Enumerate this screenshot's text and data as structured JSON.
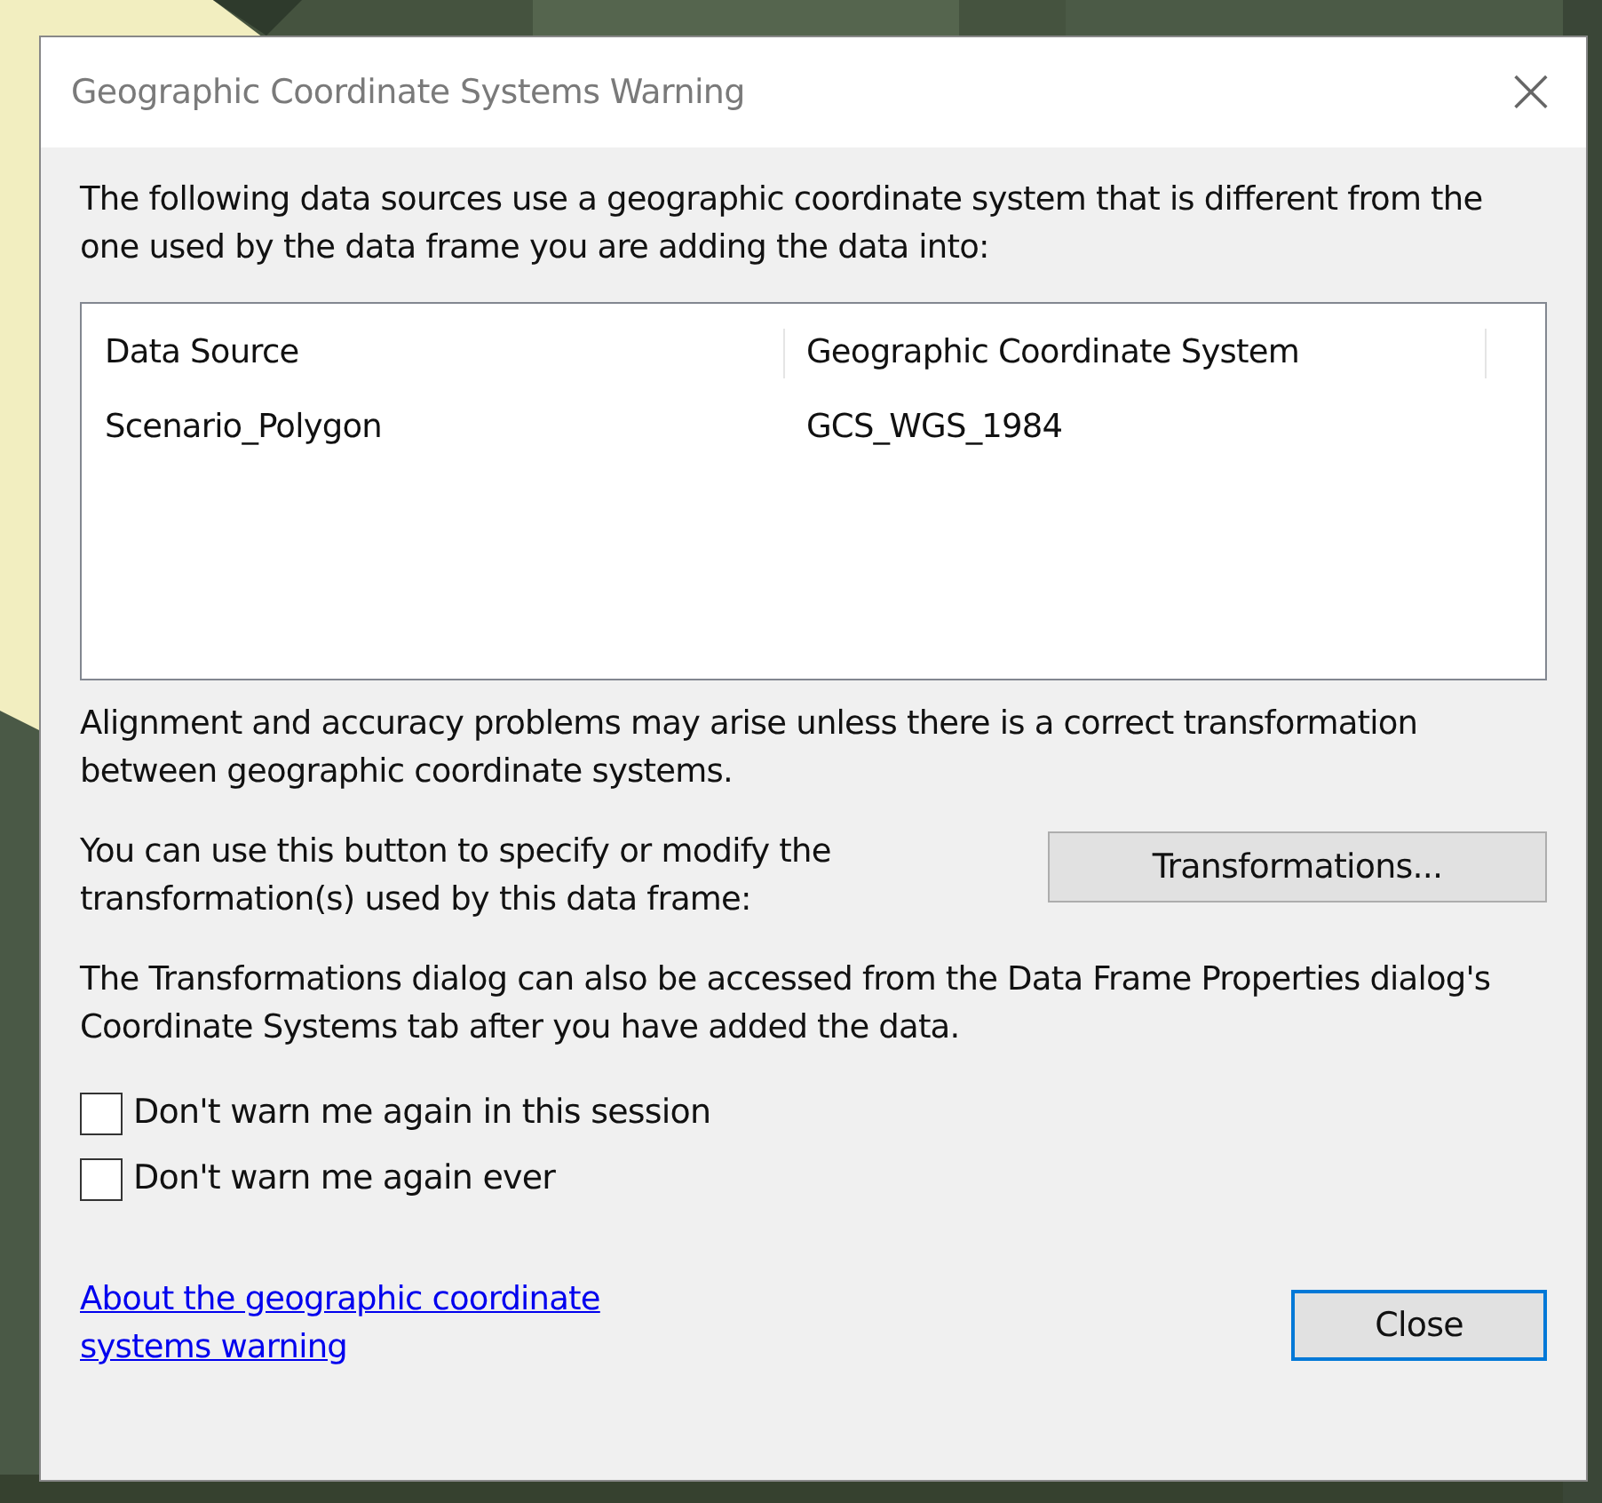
{
  "window": {
    "title": "Geographic Coordinate Systems Warning",
    "close": "×"
  },
  "intro": "The following data sources use a geographic coordinate system that is different from the one used by the data frame you are adding the data into:",
  "table": {
    "columns": [
      "Data Source",
      "Geographic Coordinate System"
    ],
    "rows": [
      [
        "Scenario_Polygon",
        "GCS_WGS_1984"
      ]
    ]
  },
  "alignment_note": "Alignment and accuracy problems may arise unless there is a correct transformation between geographic coordinate systems.",
  "transform_note": "You can use this button to specify or modify the transformation(s) used by this data frame:",
  "transform_button": "Transformations...",
  "dialog_note": "The Transformations dialog can also be accessed from the Data Frame Properties dialog's Coordinate Systems tab after you have added the data.",
  "options": [
    {
      "label": "Don't warn me again in this session",
      "checked": false
    },
    {
      "label": "Don't warn me again ever",
      "checked": false
    }
  ],
  "link": "About the geographic coordinate systems warning",
  "close_button": "Close"
}
